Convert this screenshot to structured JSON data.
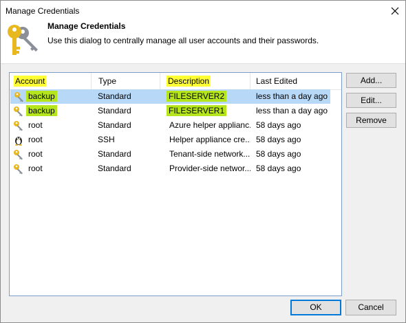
{
  "window": {
    "title": "Manage Credentials"
  },
  "header": {
    "title": "Manage Credentials",
    "subtitle": "Use this dialog to centrally manage all user accounts and their passwords."
  },
  "table": {
    "columns": [
      "Account",
      "Type",
      "Description",
      "Last Edited"
    ],
    "rows": [
      {
        "account": "backup",
        "type": "Standard",
        "description": "FILESERVER2",
        "last_edited": "less than a day ago",
        "icon": "key-icon",
        "selected": true
      },
      {
        "account": "backup",
        "type": "Standard",
        "description": "FILESERVER1",
        "last_edited": "less than a day ago",
        "icon": "key-icon",
        "selected": false
      },
      {
        "account": "root",
        "type": "Standard",
        "description": "Azure helper applianc...",
        "last_edited": "58 days ago",
        "icon": "key-icon",
        "selected": false
      },
      {
        "account": "root",
        "type": "SSH",
        "description": "Helper appliance cre...",
        "last_edited": "58 days ago",
        "icon": "linux-penguin-icon",
        "selected": false
      },
      {
        "account": "root",
        "type": "Standard",
        "description": "Tenant-side network...",
        "last_edited": "58 days ago",
        "icon": "key-icon",
        "selected": false
      },
      {
        "account": "root",
        "type": "Standard",
        "description": "Provider-side networ...",
        "last_edited": "58 days ago",
        "icon": "key-icon",
        "selected": false
      }
    ]
  },
  "buttons": {
    "add": "Add...",
    "edit": "Edit...",
    "remove": "Remove",
    "ok": "OK",
    "cancel": "Cancel"
  },
  "colors": {
    "highlight_yellow": "#ffff33",
    "highlight_green": "#b5e61d",
    "selection_blue": "#b8d8f8",
    "key_gold": "#e8b820",
    "key_gray": "#8a8f98"
  }
}
